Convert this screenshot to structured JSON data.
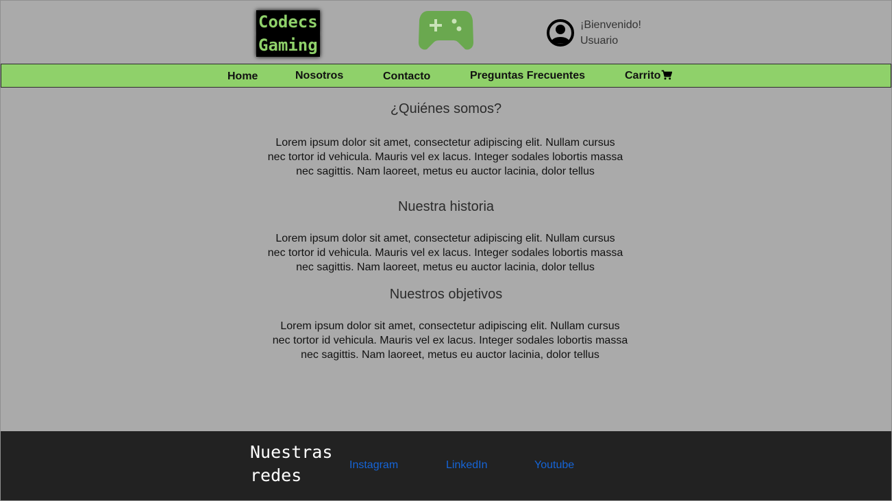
{
  "header": {
    "logo_line1": "Codecs",
    "logo_line2": "Gaming",
    "welcome_line1": "¡Bienvenido!",
    "welcome_line2": "Usuario",
    "icons": [
      "gamepad-icon",
      "user-account-icon"
    ]
  },
  "nav": {
    "home": "Home",
    "about": "Nosotros",
    "contact": "Contacto",
    "faq": "Preguntas Frecuentes",
    "cart": "Carrito"
  },
  "main": {
    "sections": [
      {
        "title": "¿Quiénes somos?",
        "text": "Lorem ipsum dolor sit amet, consectetur adipiscing elit. Nullam cursus nec tortor id vehicula. Mauris vel ex lacus. Integer sodales lobortis massa nec sagittis. Nam laoreet, metus eu auctor lacinia, dolor tellus"
      },
      {
        "title": "Nuestra historia",
        "text": "Lorem ipsum dolor sit amet, consectetur adipiscing elit. Nullam cursus nec tortor id vehicula. Mauris vel ex lacus. Integer sodales lobortis massa nec sagittis. Nam laoreet, metus eu auctor lacinia, dolor tellus"
      },
      {
        "title": "Nuestros objetivos",
        "text": "Lorem ipsum dolor sit amet, consectetur adipiscing elit. Nullam cursus nec tortor id vehicula. Mauris vel ex lacus. Integer sodales lobortis massa nec sagittis. Nam laoreet, metus eu auctor lacinia, dolor tellus"
      }
    ]
  },
  "footer": {
    "title": "Nuestras redes",
    "links": [
      "Instagram",
      "LinkedIn",
      "Youtube"
    ]
  },
  "colors": {
    "background": "#aaaaaa",
    "nav_bar": "#8fd16a",
    "accent_green": "#6aa84f",
    "footer": "#222222",
    "link": "#1565d8"
  }
}
